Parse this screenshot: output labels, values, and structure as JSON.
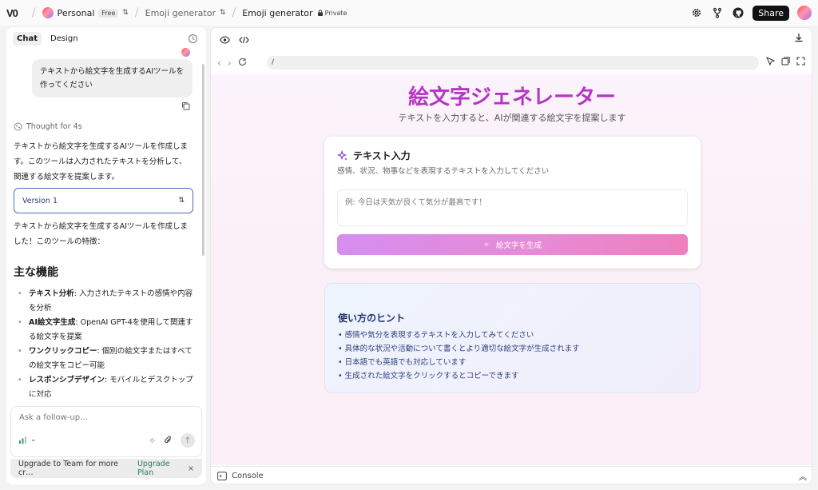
{
  "topbar": {
    "logo": "V0",
    "workspace": "Personal",
    "plan_badge": "Free",
    "project": "Emoji generator",
    "chat_title": "Emoji generator",
    "visibility": "Private",
    "share_label": "Share"
  },
  "left": {
    "tabs": [
      "Chat",
      "Design"
    ],
    "user_message": "テキストから絵文字を生成するAIツールを作ってください",
    "thought": "Thought for 4s",
    "para1": "テキストから絵文字を生成するAIツールを作成します。このツールは入力されたテキストを分析して、関連する絵文字を提案します。",
    "version_label": "Version 1",
    "para2": "テキストから絵文字を生成するAIツールを作成しました！このツールの特徴：",
    "features_heading": "主な機能",
    "features": [
      {
        "name": "テキスト分析",
        "desc": ": 入力されたテキストの感情や内容を分析"
      },
      {
        "name": "AI絵文字生成",
        "desc": ": OpenAI GPT-4を使用して関連する絵文字を提案"
      },
      {
        "name": "ワンクリックコピー",
        "desc": ": 個別の絵文字またはすべての絵文字をコピー可能"
      },
      {
        "name": "レスポンシブデザイン",
        "desc": ": モバイルとデスクトップに対応"
      }
    ],
    "composer_placeholder": "Ask a follow-up…",
    "upgrade_text": "Upgrade to Team for more cr…",
    "upgrade_link": "Upgrade Plan",
    "upgrade_close": "×"
  },
  "right": {
    "url": "/",
    "preview_title": "絵文字ジェネレーター",
    "preview_subtitle": "テキストを入力すると、AIが関連する絵文字を提案します",
    "card_title": "テキスト入力",
    "card_desc": "感情、状況、物事などを表現するテキストを入力してください",
    "input_placeholder": "例: 今日は天気が良くて気分が最高です！",
    "generate_label": "絵文字を生成",
    "hints_title": "使い方のヒント",
    "hints": [
      "• 感情や気分を表現するテキストを入力してみてください",
      "• 具体的な状況や活動について書くとより適切な絵文字が生成されます",
      "• 日本語でも英語でも対応しています",
      "• 生成された絵文字をクリックするとコピーできます"
    ],
    "console_label": "Console"
  },
  "colors": {
    "title_purple": "#b536c4",
    "button_start": "#d58ef0",
    "button_end": "#ee7fbf",
    "version_border": "#4f6fb5",
    "upgrade_link": "#2b7a5f"
  }
}
